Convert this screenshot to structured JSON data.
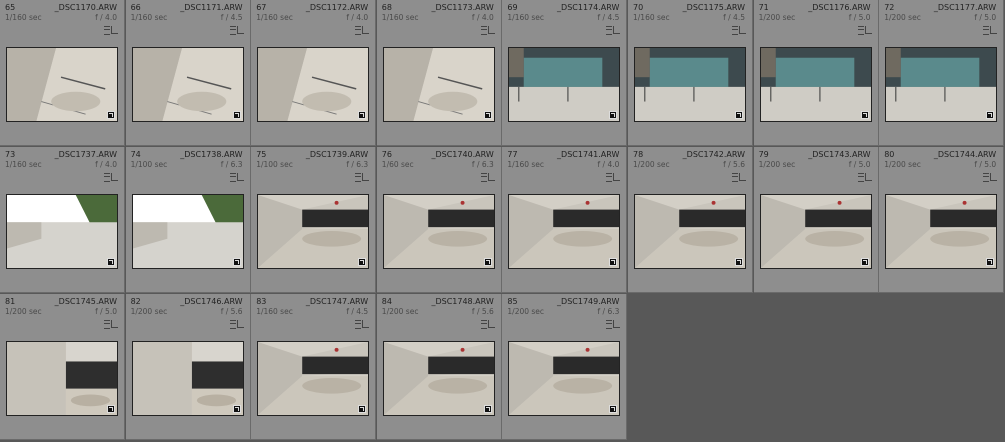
{
  "photos": [
    {
      "index": "65",
      "filename": "_DSC1170.ARW",
      "shutter": "1/160 sec",
      "aperture": "f / 4.0",
      "scene": "stairs"
    },
    {
      "index": "66",
      "filename": "_DSC1171.ARW",
      "shutter": "1/160 sec",
      "aperture": "f / 4.5",
      "scene": "stairs"
    },
    {
      "index": "67",
      "filename": "_DSC1172.ARW",
      "shutter": "1/160 sec",
      "aperture": "f / 4.0",
      "scene": "stairs"
    },
    {
      "index": "68",
      "filename": "_DSC1173.ARW",
      "shutter": "1/160 sec",
      "aperture": "f / 4.0",
      "scene": "stairs"
    },
    {
      "index": "69",
      "filename": "_DSC1174.ARW",
      "shutter": "1/160 sec",
      "aperture": "f / 4.5",
      "scene": "building"
    },
    {
      "index": "70",
      "filename": "_DSC1175.ARW",
      "shutter": "1/160 sec",
      "aperture": "f / 4.5",
      "scene": "building"
    },
    {
      "index": "71",
      "filename": "_DSC1176.ARW",
      "shutter": "1/200 sec",
      "aperture": "f / 5.0",
      "scene": "building"
    },
    {
      "index": "72",
      "filename": "_DSC1177.ARW",
      "shutter": "1/200 sec",
      "aperture": "f / 5.0",
      "scene": "building"
    },
    {
      "index": "73",
      "filename": "_DSC1737.ARW",
      "shutter": "1/160 sec",
      "aperture": "f / 4.0",
      "scene": "ramp-open"
    },
    {
      "index": "74",
      "filename": "_DSC1738.ARW",
      "shutter": "1/100 sec",
      "aperture": "f / 6.3",
      "scene": "ramp-open"
    },
    {
      "index": "75",
      "filename": "_DSC1739.ARW",
      "shutter": "1/100 sec",
      "aperture": "f / 6.3",
      "scene": "tunnel"
    },
    {
      "index": "76",
      "filename": "_DSC1740.ARW",
      "shutter": "1/60 sec",
      "aperture": "f / 6.3",
      "scene": "tunnel"
    },
    {
      "index": "77",
      "filename": "_DSC1741.ARW",
      "shutter": "1/160 sec",
      "aperture": "f / 4.0",
      "scene": "tunnel"
    },
    {
      "index": "78",
      "filename": "_DSC1742.ARW",
      "shutter": "1/200 sec",
      "aperture": "f / 5.6",
      "scene": "tunnel"
    },
    {
      "index": "79",
      "filename": "_DSC1743.ARW",
      "shutter": "1/200 sec",
      "aperture": "f / 5.0",
      "scene": "tunnel"
    },
    {
      "index": "80",
      "filename": "_DSC1744.ARW",
      "shutter": "1/200 sec",
      "aperture": "f / 5.0",
      "scene": "tunnel"
    },
    {
      "index": "81",
      "filename": "_DSC1745.ARW",
      "shutter": "1/200 sec",
      "aperture": "f / 5.0",
      "scene": "tunnel-side"
    },
    {
      "index": "82",
      "filename": "_DSC1746.ARW",
      "shutter": "1/200 sec",
      "aperture": "f / 5.6",
      "scene": "tunnel-side"
    },
    {
      "index": "83",
      "filename": "_DSC1747.ARW",
      "shutter": "1/160 sec",
      "aperture": "f / 4.5",
      "scene": "tunnel"
    },
    {
      "index": "84",
      "filename": "_DSC1748.ARW",
      "shutter": "1/200 sec",
      "aperture": "f / 5.6",
      "scene": "tunnel"
    },
    {
      "index": "85",
      "filename": "_DSC1749.ARW",
      "shutter": "1/200 sec",
      "aperture": "f / 6.3",
      "scene": "tunnel"
    }
  ],
  "icons": {
    "metadata": "metadata-icon",
    "edit_badge": "edit-badge-icon"
  }
}
